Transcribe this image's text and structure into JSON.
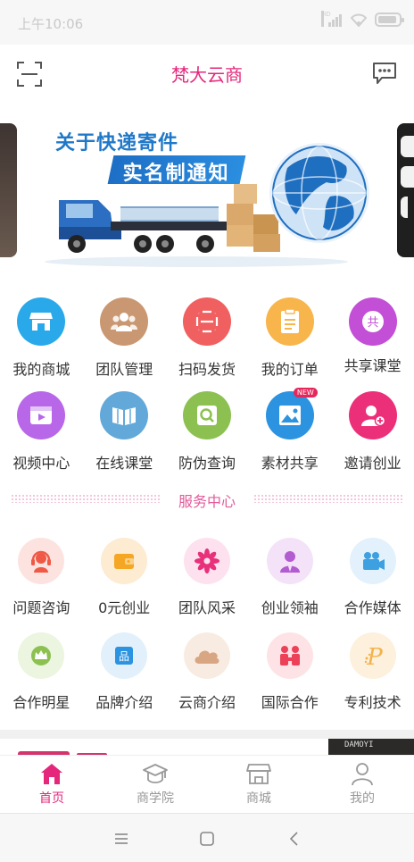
{
  "status_bar": {
    "time": "上午10:06"
  },
  "header": {
    "title": "梵大云商",
    "scan_icon": "scan-icon",
    "message_icon": "message-icon"
  },
  "banner": {
    "line1": "关于快递寄件",
    "line2": "实名制通知"
  },
  "menu_row1": [
    {
      "label": "我的商城",
      "icon": "store-icon",
      "color": "#29a9ea"
    },
    {
      "label": "团队管理",
      "icon": "team-icon",
      "color": "#c99872"
    },
    {
      "label": "扫码发货",
      "icon": "scan-ship-icon",
      "color": "#f06060"
    },
    {
      "label": "我的订单",
      "icon": "order-icon",
      "color": "#f7b54c"
    },
    {
      "label": "共享课堂",
      "icon": "shared-class-icon",
      "color": "#c24fd6"
    }
  ],
  "menu_row2": [
    {
      "label": "视频中心",
      "icon": "video-icon",
      "color": "#b867e8"
    },
    {
      "label": "在线课堂",
      "icon": "book-icon",
      "color": "#62a8d9"
    },
    {
      "label": "防伪查询",
      "icon": "search-icon",
      "color": "#8cc152"
    },
    {
      "label": "素材共享",
      "icon": "image-icon",
      "color": "#2c93e0",
      "badge": "NEW"
    },
    {
      "label": "邀请创业",
      "icon": "invite-icon",
      "color": "#ec2f79"
    }
  ],
  "service_center": {
    "title": "服务中心"
  },
  "service_row1": [
    {
      "label": "问题咨询",
      "icon": "headset-icon",
      "color": "#fde3e0"
    },
    {
      "label": "0元创业",
      "icon": "wallet-icon",
      "color": "#fdebd2"
    },
    {
      "label": "团队风采",
      "icon": "flower-icon",
      "color": "#fde1ee"
    },
    {
      "label": "创业领袖",
      "icon": "leader-icon",
      "color": "#f4e2f8"
    },
    {
      "label": "合作媒体",
      "icon": "camera-icon",
      "color": "#e2f1fb"
    }
  ],
  "service_row2": [
    {
      "label": "合作明星",
      "icon": "crown-icon",
      "color": "#ebf5df"
    },
    {
      "label": "品牌介绍",
      "icon": "brand-icon",
      "color": "#e2f0fb"
    },
    {
      "label": "云商介绍",
      "icon": "cloud-icon",
      "color": "#f8ece2"
    },
    {
      "label": "国际合作",
      "icon": "handshake-icon",
      "color": "#fde3e6"
    },
    {
      "label": "专利技术",
      "icon": "patent-icon",
      "color": "#fdf0dc"
    }
  ],
  "tabbar": {
    "items": [
      {
        "label": "首页",
        "icon": "home-icon",
        "active": true
      },
      {
        "label": "商学院",
        "icon": "graduation-cap-icon",
        "active": false
      },
      {
        "label": "商城",
        "icon": "shop-icon",
        "active": false
      },
      {
        "label": "我的",
        "icon": "user-icon",
        "active": false
      }
    ]
  },
  "colors": {
    "brand": "#e5277c",
    "inactive": "#999999"
  }
}
